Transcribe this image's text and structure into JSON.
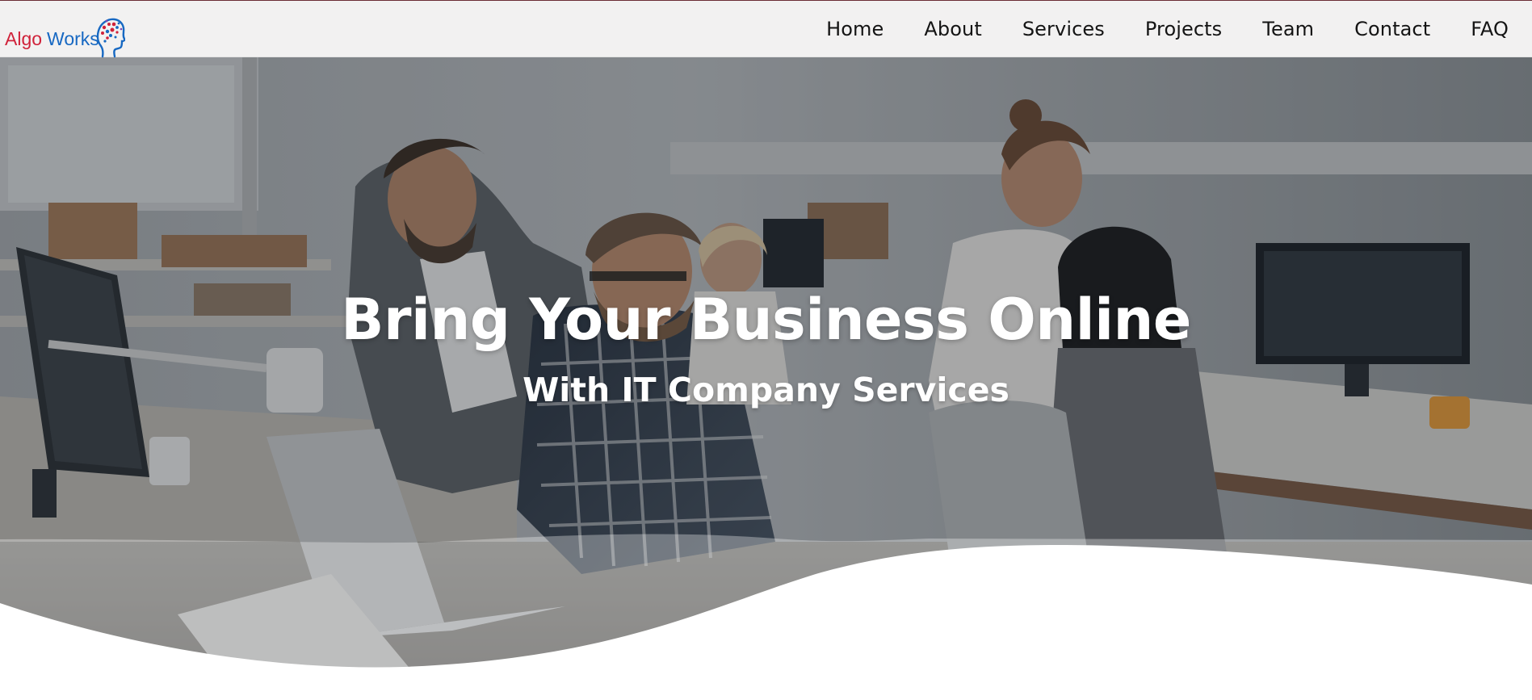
{
  "brand": {
    "name_part1": "Algo",
    "name_part2": "Works",
    "colors": {
      "red": "#d0223a",
      "blue": "#1768c2"
    }
  },
  "nav": {
    "items": [
      {
        "label": "Home"
      },
      {
        "label": "About"
      },
      {
        "label": "Services"
      },
      {
        "label": "Projects"
      },
      {
        "label": "Team"
      },
      {
        "label": "Contact"
      },
      {
        "label": "FAQ"
      }
    ]
  },
  "hero": {
    "title": "Bring Your Business Online",
    "subtitle": "With IT Company Services"
  },
  "colors": {
    "top_border": "#6a2d35",
    "navbar_bg": "#f2f1f1",
    "nav_text": "#141414",
    "hero_text": "#ffffff"
  }
}
